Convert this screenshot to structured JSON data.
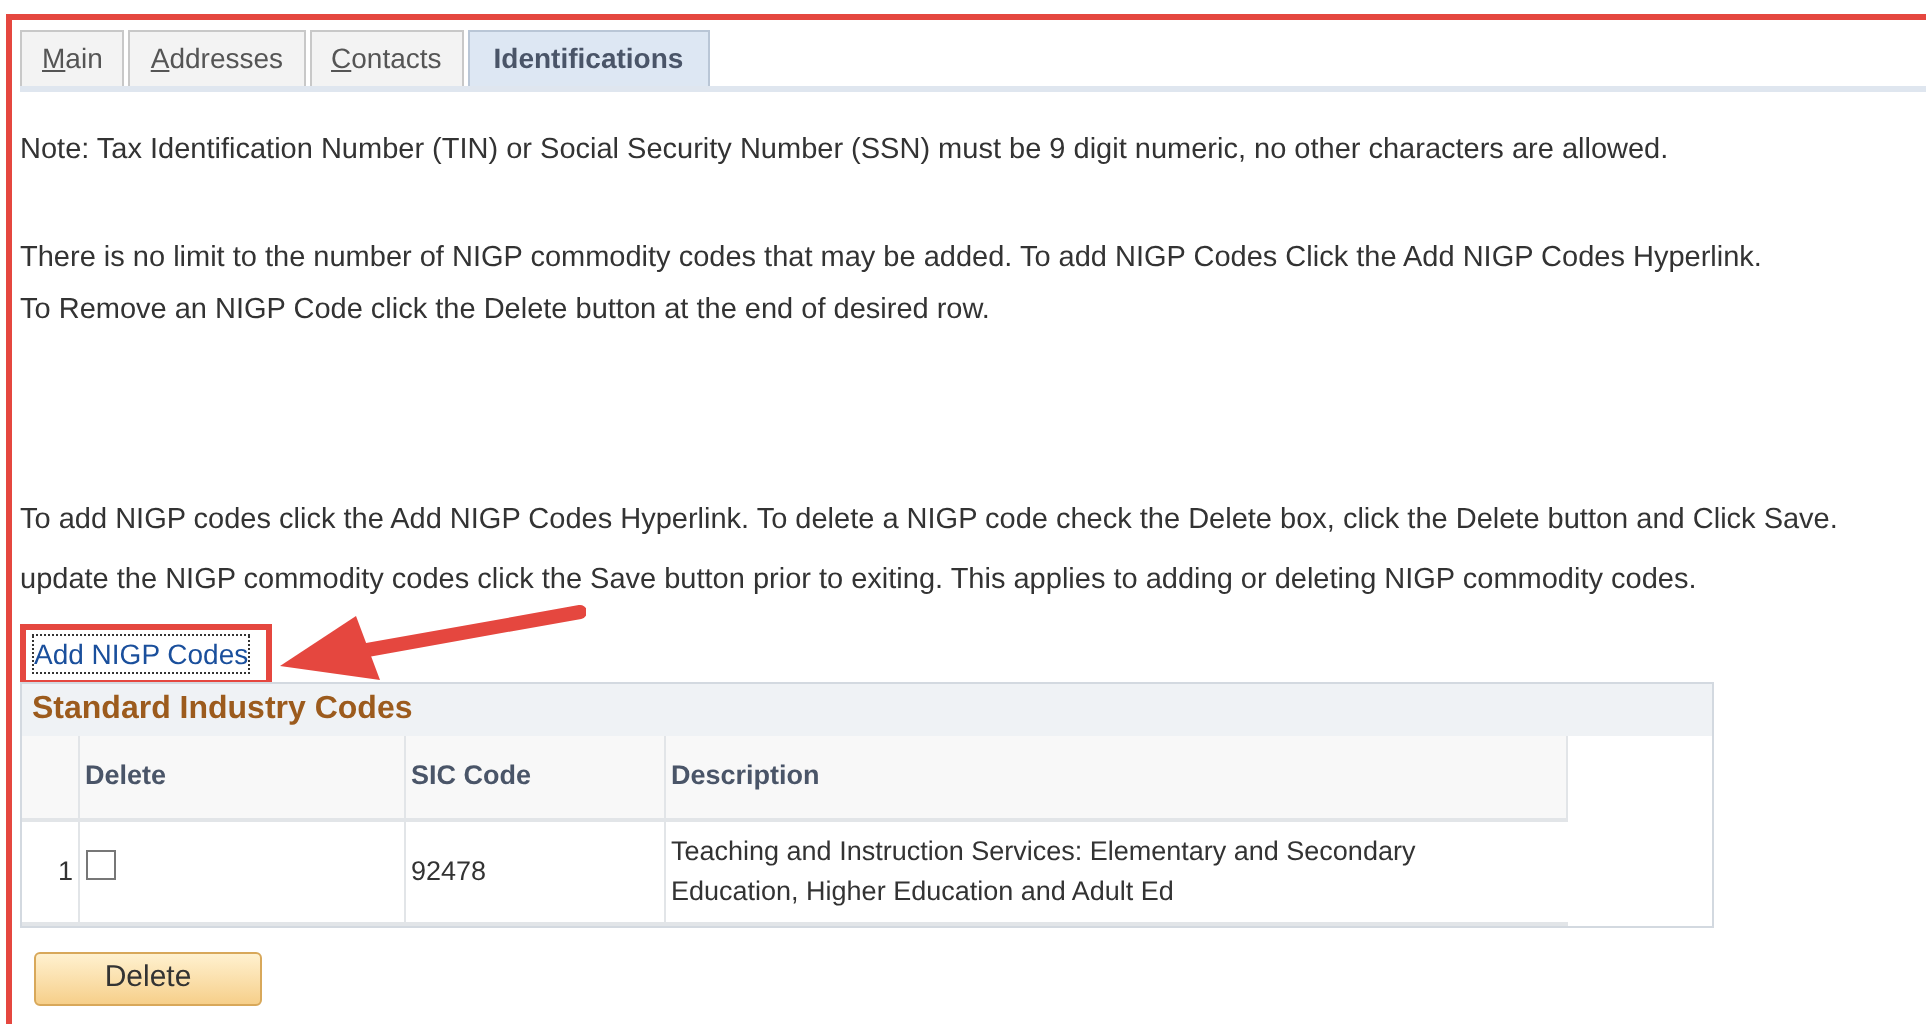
{
  "tabs": [
    {
      "label": "Main",
      "selected": false
    },
    {
      "label": "Addresses",
      "selected": false
    },
    {
      "label": "Contacts",
      "selected": false
    },
    {
      "label": "Identifications",
      "selected": true
    }
  ],
  "note": "Note: Tax Identification Number (TIN) or Social Security Number (SSN) must be 9 digit numeric, no other characters are allowed.",
  "paragraph_1": [
    "There is no limit to the number of NIGP commodity codes that may be added. To add NIGP Codes Click the Add NIGP Codes Hyperlink.",
    "To Remove an NIGP Code click the Delete button at the end of desired row."
  ],
  "paragraph_2": [
    "To add NIGP codes click the Add NIGP Codes Hyperlink. To delete a NIGP code check the Delete box, click the Delete button and Click Save.",
    "update the NIGP commodity codes click the Save button prior to exiting. This applies to adding or deleting NIGP commodity codes."
  ],
  "link": "Add NIGP Codes",
  "section": {
    "title": "Standard Industry Codes",
    "columns": [
      "Delete",
      "SIC Code",
      "Description"
    ],
    "rows": [
      {
        "number": "1",
        "checked": false,
        "sic_code": "92478",
        "description": "Teaching and Instruction Services: Elementary and Secondary Education, Higher Education and Adult Ed"
      }
    ]
  },
  "delete_button": "Delete"
}
